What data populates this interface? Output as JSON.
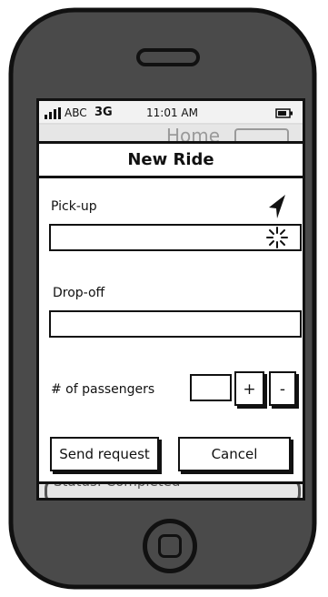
{
  "status_bar": {
    "carrier": "ABC",
    "network": "3G",
    "time": "11:01 AM"
  },
  "background_screen": {
    "title_peek": "Home",
    "list_item_status": "Status: Completed"
  },
  "dialog": {
    "title": "New Ride",
    "pickup_label": "Pick-up",
    "pickup_value": "",
    "dropoff_label": "Drop-off",
    "dropoff_value": "",
    "passengers_label": "# of passengers",
    "passengers_value": "",
    "plus_label": "+",
    "minus_label": "-",
    "send_label": "Send request",
    "cancel_label": "Cancel"
  },
  "icons": {
    "location": "location-arrow-icon",
    "loading": "loading-spinner-icon",
    "signal": "signal-bars-icon",
    "battery": "battery-icon"
  },
  "colors": {
    "phone_body": "#4a4a4a",
    "screen_bg": "#e6e6e6",
    "ink": "#111111"
  }
}
